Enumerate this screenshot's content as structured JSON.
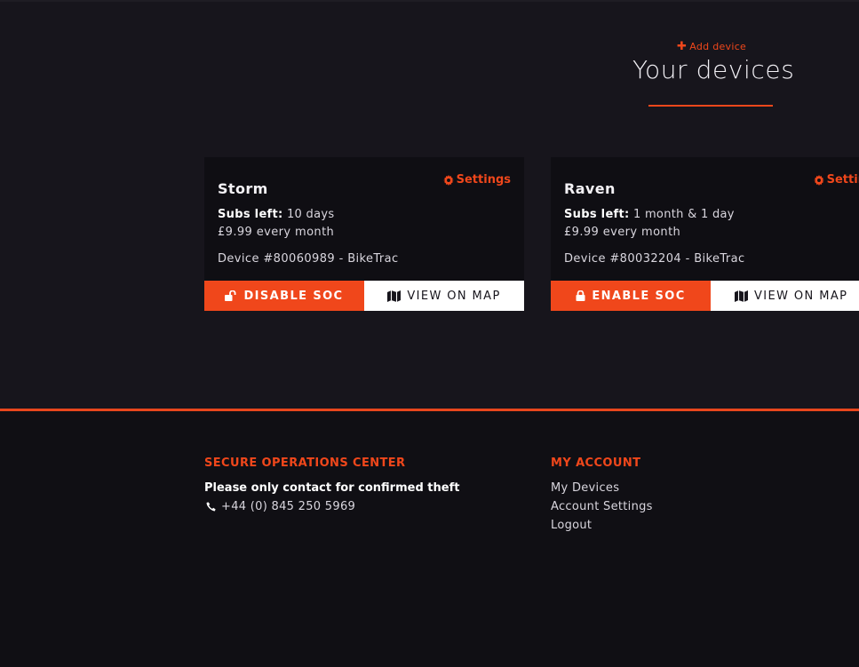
{
  "header": {
    "add_device_label": "Add device",
    "title": "Your devices"
  },
  "devices": [
    {
      "name": "Storm",
      "settings_label": "Settings",
      "subs_label": "Subs left:",
      "subs_value": "10 days",
      "price": "£9.99 every month",
      "device_info": "Device #80060989 - BikeTrac",
      "soc_button": "DISABLE SOC",
      "soc_icon": "unlock-icon",
      "map_button": "VIEW ON MAP"
    },
    {
      "name": "Raven",
      "settings_label": "Settings",
      "subs_label": "Subs left:",
      "subs_value": "1 month & 1 day",
      "price": "£9.99 every month",
      "device_info": "Device #80032204 - BikeTrac",
      "soc_button": "ENABLE SOC",
      "soc_icon": "lock-icon",
      "map_button": "VIEW ON MAP"
    }
  ],
  "footer": {
    "soc_heading": "SECURE OPERATIONS CENTER",
    "soc_note": "Please only contact for confirmed theft",
    "phone": "+44 (0) 845 250 5969",
    "account_heading": "MY ACCOUNT",
    "links": [
      "My Devices",
      "Account Settings",
      "Logout"
    ]
  },
  "colors": {
    "accent": "#f0471b",
    "background": "#17151c",
    "card": "#0f0e13",
    "footer": "#100f14"
  }
}
